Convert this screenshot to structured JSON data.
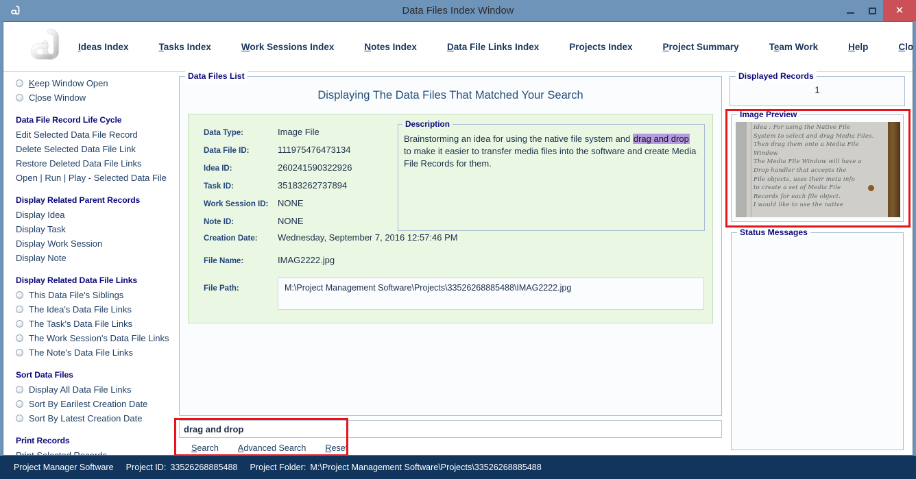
{
  "window": {
    "title": "Data Files Index Window",
    "icon": "app-paperclip-icon",
    "minimize_label": "–",
    "maximize_label": "□",
    "close_label": "✕"
  },
  "menu": {
    "logo_icon": "app-paperclip-logo",
    "items": [
      {
        "label": "Ideas Index",
        "accel": "I"
      },
      {
        "label": "Tasks Index",
        "accel": "T"
      },
      {
        "label": "Work Sessions Index",
        "accel": "W"
      },
      {
        "label": "Notes Index",
        "accel": "N"
      },
      {
        "label": "Data File Links Index",
        "accel": "D"
      },
      {
        "label": "Projects Index",
        "accel": "P"
      },
      {
        "label": "Project Summary",
        "accel": "P"
      },
      {
        "label": "Team Work",
        "accel": "e"
      },
      {
        "label": "Help",
        "accel": "H"
      },
      {
        "label": "Close Program",
        "accel": "C"
      }
    ]
  },
  "sidebar": {
    "window_options": [
      {
        "label": "Keep Window Open",
        "type": "radio",
        "selected": false
      },
      {
        "label": "Close Window",
        "type": "radio",
        "selected": false
      }
    ],
    "groups": [
      {
        "title": "Data File Record Life Cycle",
        "type": "links",
        "items": [
          "Edit Selected Data File Record",
          "Delete Selected Data File Link",
          "Restore Deleted Data File Links",
          "Open | Run | Play - Selected Data File"
        ]
      },
      {
        "title": "Display Related Parent Records",
        "type": "links",
        "items": [
          "Display Idea",
          "Display Task",
          "Display Work Session",
          "Display Note"
        ]
      },
      {
        "title": "Display Related Data File Links",
        "type": "radios",
        "items": [
          "This Data File's Siblings",
          "The Idea's Data File Links",
          "The Task's Data File Links",
          "The Work Session's Data File Links",
          "The Note's Data File Links"
        ]
      },
      {
        "title": "Sort Data Files",
        "type": "radios",
        "items": [
          "Display All Data File Links",
          "Sort By Earilest Creation Date",
          "Sort By Latest Creation Date"
        ]
      },
      {
        "title": "Print Records",
        "type": "links",
        "items": [
          "Print Selected Records"
        ]
      }
    ]
  },
  "center": {
    "legend": "Data Files List",
    "heading": "Displaying The Data Files That Matched Your Search",
    "record": {
      "fields": [
        {
          "label": "Data Type:",
          "value": "Image File"
        },
        {
          "label": "Data File ID:",
          "value": "111975476473134"
        },
        {
          "label": "Idea ID:",
          "value": "260241590322926"
        },
        {
          "label": "Task ID:",
          "value": "35183262737894"
        },
        {
          "label": "Work Session ID:",
          "value": "NONE"
        },
        {
          "label": "Note ID:",
          "value": "NONE"
        }
      ],
      "creation_date_label": "Creation Date:",
      "creation_date_value": "Wednesday, September 7, 2016   12:57:46 PM",
      "file_name_label": "File Name:",
      "file_name_value": "IMAG2222.jpg",
      "file_path_label": "File Path:",
      "file_path_value": "M:\\Project Management Software\\Projects\\33526268885488\\IMAG2222.jpg"
    },
    "description": {
      "legend": "Description",
      "text_before": "Brainstorming an idea for using the native file system and ",
      "highlight": "drag and drop",
      "highlight_color": "#b69ae0",
      "text_after": " to make it easier to transfer media files into the software and create Media File Records for them."
    }
  },
  "search": {
    "value": "drag and drop",
    "placeholder": "",
    "links": [
      {
        "label": "Search",
        "accel": "S"
      },
      {
        "label": "Advanced Search",
        "accel": "A"
      },
      {
        "label": "Reset",
        "accel": "R"
      }
    ],
    "highlight_color": "#e8131a"
  },
  "right": {
    "displayed_records": {
      "legend": "Displayed Records",
      "value": "1"
    },
    "image_preview": {
      "legend": "Image Preview",
      "highlight_color": "#e8131a",
      "alt": "handwritten-note-photo",
      "handwriting": "Idea : For using the Native File\nSystem to select and drag Media Files.\nThen drag them onto a Media File Window\nThe Media File Window will have a\nDrop handler that accepts the\nFile objects, uses their meta info\nto create a set of Media File\nRecords for each file object.\nI would like to use the native"
    },
    "status_messages": {
      "legend": "Status Messages",
      "value": ""
    }
  },
  "statusbar": {
    "app_name": "Project Manager Software",
    "project_id_label": "Project ID:",
    "project_id_value": "33526268885488",
    "project_folder_label": "Project Folder:",
    "project_folder_value": "M:\\Project Management Software\\Projects\\33526268885488"
  }
}
